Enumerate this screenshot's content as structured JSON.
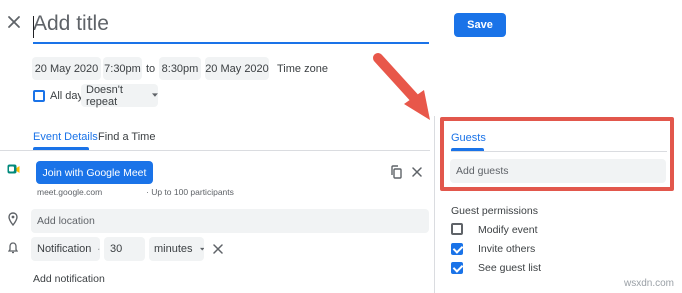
{
  "header": {
    "title_placeholder": "Add title",
    "save_label": "Save"
  },
  "datetime": {
    "start_date": "20 May 2020",
    "start_time": "7:30pm",
    "separator": "to",
    "end_time": "8:30pm",
    "end_date": "20 May 2020",
    "timezone_label": "Time zone"
  },
  "options": {
    "all_day_label": "All day",
    "all_day_checked": false,
    "repeat_value": "Doesn't repeat"
  },
  "tabs": [
    {
      "label": "Event Details",
      "active": true
    },
    {
      "label": "Find a Time",
      "active": false
    }
  ],
  "meet": {
    "button_label": "Join with Google Meet",
    "link": "meet.google.com",
    "participants": "· Up to 100 participants"
  },
  "location": {
    "placeholder": "Add location"
  },
  "notification": {
    "type": "Notification",
    "amount": "30",
    "unit": "minutes",
    "add_label": "Add notification"
  },
  "guests": {
    "tab_label": "Guests",
    "input_placeholder": "Add guests",
    "permissions_title": "Guest permissions",
    "permissions": [
      {
        "label": "Modify event",
        "checked": false
      },
      {
        "label": "Invite others",
        "checked": true
      },
      {
        "label": "See guest list",
        "checked": true
      }
    ]
  },
  "colors": {
    "accent": "#1a73e8",
    "highlight_box": "#e2574c",
    "arrow": "#e8574a",
    "meet_icon": "#00897b"
  },
  "watermark": "wsxdn.com"
}
